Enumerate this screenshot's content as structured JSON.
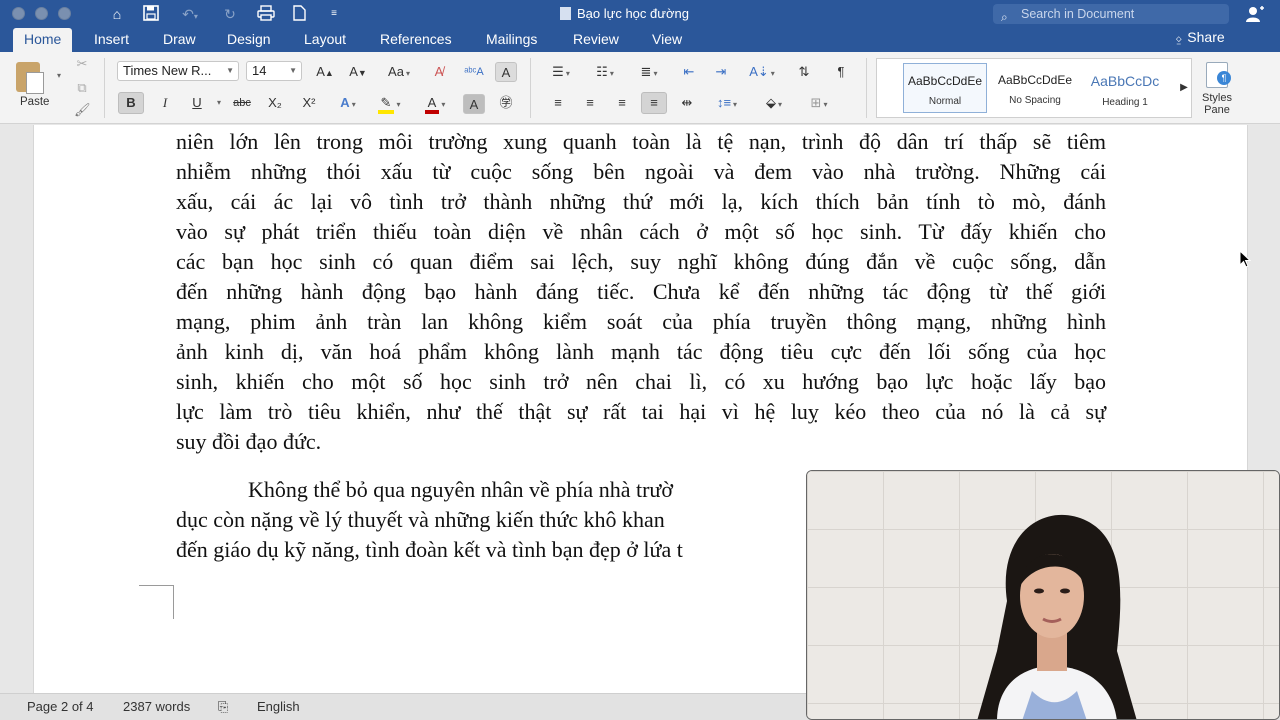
{
  "title_bar": {
    "document_title": "Bạo lực học đường",
    "search_placeholder": "Search in Document",
    "quick_access_icons": [
      "home-icon",
      "save-icon",
      "undo-icon",
      "redo-icon",
      "print-icon",
      "new-doc-icon",
      "customize-icon"
    ]
  },
  "tabs": [
    "Home",
    "Insert",
    "Draw",
    "Design",
    "Layout",
    "References",
    "Mailings",
    "Review",
    "View"
  ],
  "active_tab": "Home",
  "share_label": "Share",
  "ribbon": {
    "paste_label": "Paste",
    "font_name": "Times New R...",
    "font_size": "14",
    "format_buttons": [
      "B",
      "I",
      "U",
      "abc",
      "X₂",
      "X²"
    ],
    "styles": [
      {
        "sample": "AaBbCcDdEe",
        "name": "Normal"
      },
      {
        "sample": "AaBbCcDdEe",
        "name": "No Spacing"
      },
      {
        "sample": "AaBbCcDc",
        "name": "Heading 1"
      }
    ],
    "styles_pane_label_1": "Styles",
    "styles_pane_label_2": "Pane"
  },
  "document": {
    "paragraph1_lines": [
      "niên lớn lên trong môi trường xung quanh toàn là tệ nạn, trình độ dân trí thấp sẽ tiêm",
      "nhiễm những thói xấu từ cuộc sống bên ngoài và đem vào nhà trường. Những cái",
      "xấu, cái ác lại vô tình trở thành những thứ mới lạ, kích thích bản tính tò mò, đánh",
      "vào sự phát triển thiếu toàn diện về nhân cách ở một số học sinh. Từ đấy khiến cho",
      "các bạn học sinh có quan điểm sai lệch, suy nghĩ không đúng đắn về cuộc sống, dẫn",
      "đến những hành động bạo hành đáng tiếc. Chưa kể đến những tác động từ thế giới",
      "mạng, phim ảnh tràn lan không kiểm soát của phía truyền thông mạng, những hình",
      "ảnh kinh dị, văn hoá phẩm không lành mạnh tác động tiêu cực đến lối sống của học",
      "sinh, khiến cho một số học sinh trở nên chai lì, có xu hướng bạo lực hoặc lấy bạo",
      "lực làm trò tiêu khiển, như thế thật sự rất tai hại vì hệ luỵ kéo theo của nó là cả sự",
      "suy đồi đạo đức."
    ],
    "paragraph2_lines": [
      "Không thể bỏ qua nguyên nhân về phía nhà trườ",
      "dục còn nặng về lý thuyết và những kiến thức khô khan",
      "đến giáo dụ kỹ năng, tình đoàn kết và tình bạn đẹp ở lứa t"
    ]
  },
  "status_bar": {
    "page": "Page 2 of 4",
    "words": "2387 words",
    "language": "English"
  },
  "colors": {
    "title_bar": "#2b579a",
    "ribbon": "#f3f3f3",
    "page": "#ffffff"
  }
}
